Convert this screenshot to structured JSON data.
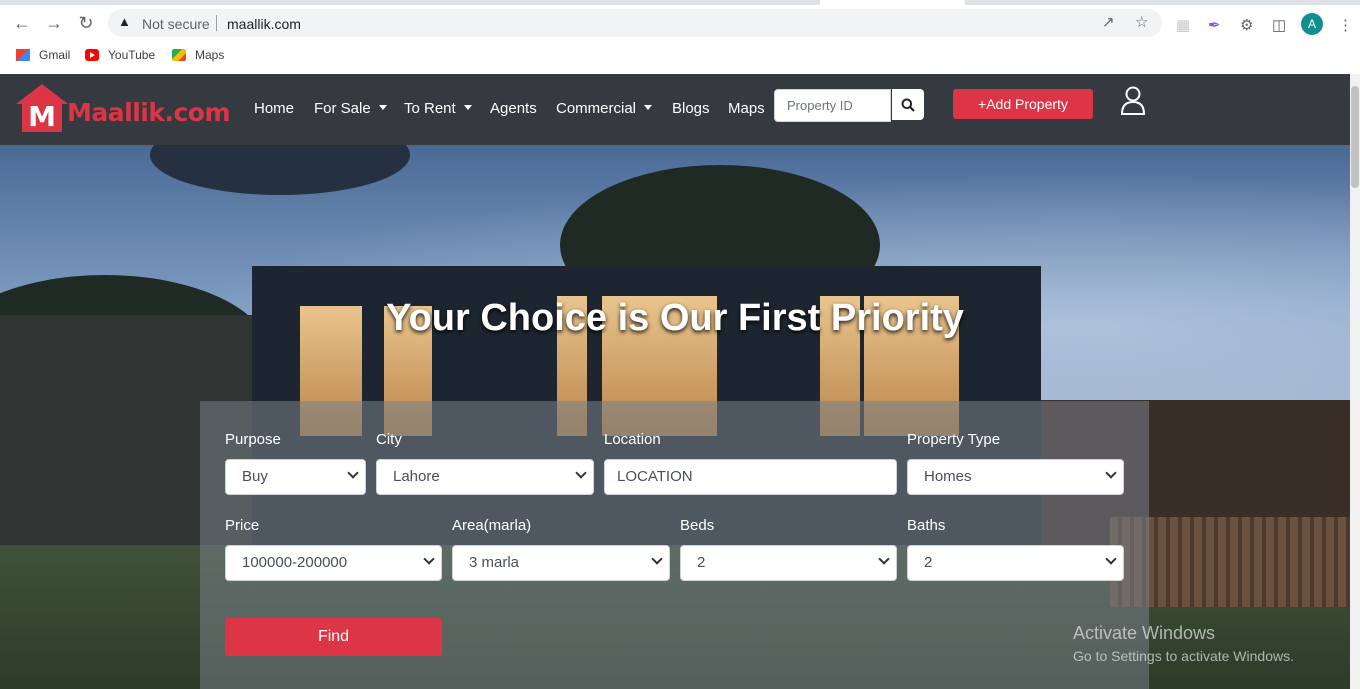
{
  "browser": {
    "security_label": "Not secure",
    "url": "maallik.com",
    "profile_initial": "A",
    "bookmarks": [
      {
        "label": "Gmail",
        "icon": "gmail-icon"
      },
      {
        "label": "YouTube",
        "icon": "youtube-icon"
      },
      {
        "label": "Maps",
        "icon": "maps-icon"
      }
    ]
  },
  "site": {
    "logo_letter": "M",
    "logo_text": "Maallik.com",
    "nav": [
      {
        "label": "Home",
        "dropdown": false
      },
      {
        "label": "For Sale",
        "dropdown": true
      },
      {
        "label": "To Rent",
        "dropdown": true
      },
      {
        "label": "Agents",
        "dropdown": false
      },
      {
        "label": "Commercial",
        "dropdown": true
      },
      {
        "label": "Blogs",
        "dropdown": false
      },
      {
        "label": "Maps",
        "dropdown": false
      }
    ],
    "property_id_placeholder": "Property ID",
    "add_property_label": "+Add Property",
    "accent_color": "#dc3545"
  },
  "hero": {
    "title": "Your Choice is Our First Priority",
    "form": {
      "purpose": {
        "label": "Purpose",
        "value": "Buy"
      },
      "city": {
        "label": "City",
        "value": "Lahore"
      },
      "location": {
        "label": "Location",
        "placeholder": "LOCATION"
      },
      "property_type": {
        "label": "Property Type",
        "value": "Homes"
      },
      "price": {
        "label": "Price",
        "value": "100000-200000"
      },
      "area": {
        "label": "Area(marla)",
        "value": "3 marla"
      },
      "beds": {
        "label": "Beds",
        "value": "2"
      },
      "baths": {
        "label": "Baths",
        "value": "2"
      },
      "find_label": "Find"
    }
  },
  "watermark": {
    "line1": "Activate Windows",
    "line2": "Go to Settings to activate Windows."
  }
}
